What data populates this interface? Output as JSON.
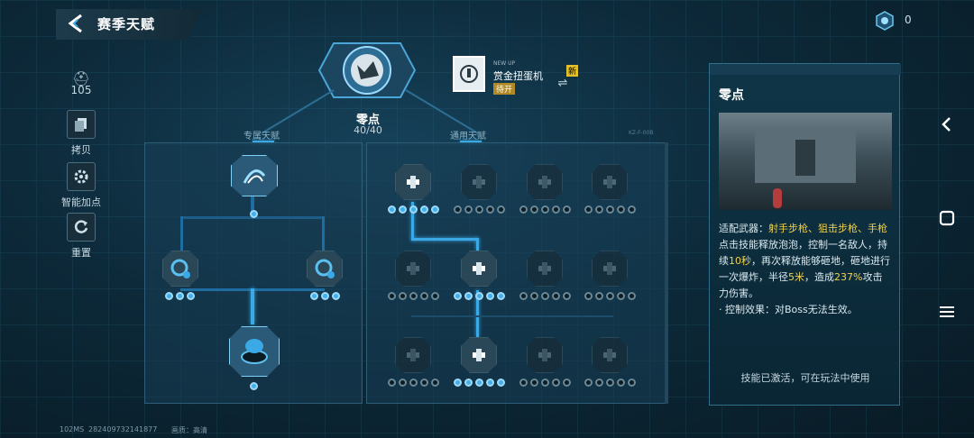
{
  "header": {
    "title": "赛季天赋",
    "currency_value": "0"
  },
  "sidebar": {
    "level": "105",
    "items": [
      {
        "label": "拷贝"
      },
      {
        "label": "智能加点"
      },
      {
        "label": "重置"
      }
    ]
  },
  "center": {
    "talent_name": "零点",
    "points": "40/40",
    "gacha": {
      "tag": "NEW UP",
      "name": "赏金扭蛋机",
      "badge": "待开",
      "new_label": "新"
    },
    "tabs": [
      "专属天赋",
      "通用天赋"
    ],
    "panel_tag": "KZ-F-00B"
  },
  "exclusive_tree": {
    "top_node_level": 1,
    "side_nodes": [
      {
        "filled": 3,
        "total": 3
      },
      {
        "filled": 3,
        "total": 3
      }
    ],
    "bottom_node_filled": 1
  },
  "general_tree": {
    "rows": [
      [
        {
          "filled": 5,
          "total": 5,
          "active": true
        },
        {
          "filled": 0,
          "total": 5
        },
        {
          "filled": 0,
          "total": 5
        },
        {
          "filled": 0,
          "total": 5
        }
      ],
      [
        {
          "filled": 0,
          "total": 5
        },
        {
          "filled": 5,
          "total": 5,
          "active": true
        },
        {
          "filled": 0,
          "total": 5
        },
        {
          "filled": 0,
          "total": 5
        }
      ],
      [
        {
          "filled": 0,
          "total": 5
        },
        {
          "filled": 5,
          "total": 5,
          "active": true
        },
        {
          "filled": 0,
          "total": 5
        },
        {
          "filled": 0,
          "total": 5
        }
      ]
    ]
  },
  "detail": {
    "title": "零点",
    "desc_prefix": "适配武器：",
    "desc_weapons": "射手步枪、狙击步枪、手枪",
    "desc_p1": "点击技能释放泡泡，控制一名敌人，持续",
    "desc_h1": "10秒",
    "desc_p2": "，再次释放能够砸地，砸地进行一次爆炸，半径",
    "desc_h2": "5米",
    "desc_p3": "，造成",
    "desc_h3": "237%",
    "desc_p4": "攻击力伤害。",
    "desc_control": "· 控制效果：对Boss无法生效。",
    "footer": "技能已激活，可在玩法中使用"
  },
  "status": {
    "ping": "102MS",
    "uid": "282409732141877",
    "quality_label": "画质：高清"
  },
  "colors": {
    "accent": "#3aa9e6",
    "highlight": "#f1d24d"
  }
}
